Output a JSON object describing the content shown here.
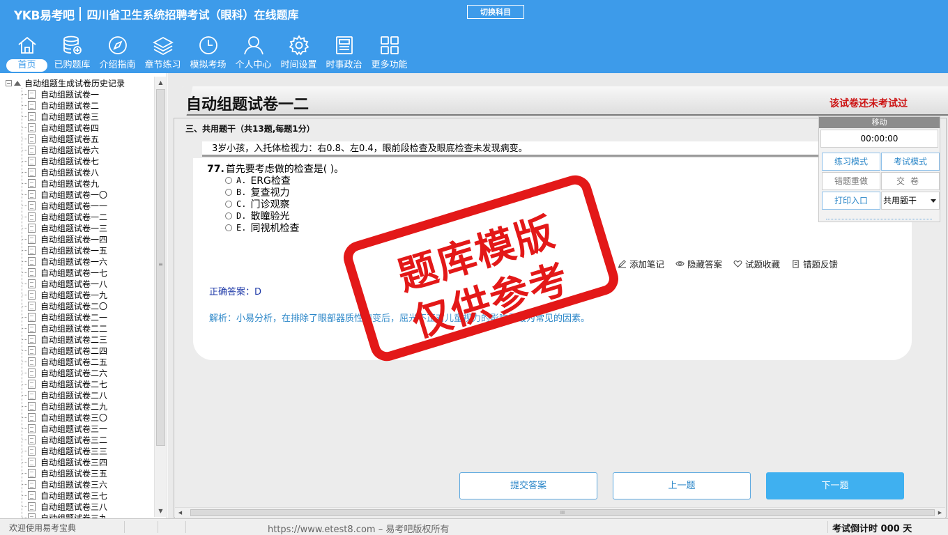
{
  "header": {
    "logo": "YKB易考吧",
    "title": "四川省卫生系统招聘考试（眼科）在线题库",
    "switch_subject": "切换科目"
  },
  "nav": [
    {
      "label": "首页",
      "icon": "home-icon",
      "active": true
    },
    {
      "label": "已购题库",
      "icon": "database-icon"
    },
    {
      "label": "介绍指南",
      "icon": "compass-icon"
    },
    {
      "label": "章节练习",
      "icon": "layers-icon"
    },
    {
      "label": "模拟考场",
      "icon": "clock-icon"
    },
    {
      "label": "个人中心",
      "icon": "user-icon"
    },
    {
      "label": "时间设置",
      "icon": "gear-icon"
    },
    {
      "label": "时事政治",
      "icon": "newspaper-icon"
    },
    {
      "label": "更多功能",
      "icon": "grid-icon"
    }
  ],
  "sidebar": {
    "root_label": "自动组题生成试卷历史记录",
    "items": [
      "自动组题试卷一",
      "自动组题试卷二",
      "自动组题试卷三",
      "自动组题试卷四",
      "自动组题试卷五",
      "自动组题试卷六",
      "自动组题试卷七",
      "自动组题试卷八",
      "自动组题试卷九",
      "自动组题试卷一〇",
      "自动组题试卷一一",
      "自动组题试卷一二",
      "自动组题试卷一三",
      "自动组题试卷一四",
      "自动组题试卷一五",
      "自动组题试卷一六",
      "自动组题试卷一七",
      "自动组题试卷一八",
      "自动组题试卷一九",
      "自动组题试卷二〇",
      "自动组题试卷二一",
      "自动组题试卷二二",
      "自动组题试卷二三",
      "自动组题试卷二四",
      "自动组题试卷二五",
      "自动组题试卷二六",
      "自动组题试卷二七",
      "自动组题试卷二八",
      "自动组题试卷二九",
      "自动组题试卷三〇",
      "自动组题试卷三一",
      "自动组题试卷三二",
      "自动组题试卷三三",
      "自动组题试卷三四",
      "自动组题试卷三五",
      "自动组题试卷三六",
      "自动组题试卷三七",
      "自动组题试卷三八",
      "自动组题试卷三九"
    ],
    "scroll_grip": "≡"
  },
  "paper": {
    "title": "自动组题试卷一二",
    "status": "该试卷还未考试过",
    "section": "三、共用题干（共13题,每题1分）",
    "stem": "3岁小孩，入托体检视力：右0.8、左0.4，眼前段检查及眼底检查未发现病变。",
    "question_number": "77.",
    "question_text": "首先要考虑做的检查是( )。",
    "options": [
      {
        "key": "A.",
        "text": "ERG检查"
      },
      {
        "key": "B.",
        "text": "复查视力"
      },
      {
        "key": "C.",
        "text": "门诊观察"
      },
      {
        "key": "D.",
        "text": "散瞳验光"
      },
      {
        "key": "E.",
        "text": "同视机检查"
      }
    ],
    "actions": {
      "note": "添加笔记",
      "hide_answer": "隐藏答案",
      "favorite": "试题收藏",
      "feedback": "错题反馈"
    },
    "answer": "正确答案：D",
    "analysis": "解析：小易分析，在排除了眼部器质性病变后，屈光不正对儿童视力的影响是最为常见的因素。"
  },
  "watermark": {
    "line1": "题库模版",
    "line2": "仅供参考",
    "color": "#e31818"
  },
  "panel": {
    "header": "移动",
    "timer": "00:00:00",
    "practice_mode": "练习模式",
    "exam_mode": "考试模式",
    "redo_wrong": "错题重做",
    "hand_in": "交卷",
    "print_entry": "打印入口",
    "question_type": "共用题干"
  },
  "buttons": {
    "submit": "提交答案",
    "prev": "上一题",
    "next": "下一题"
  },
  "hscroll_grip": "III",
  "status": {
    "welcome": "欢迎使用易考宝典",
    "url": "https://www.etest8.com – 易考吧版权所有",
    "countdown": "考试倒计时 000 天"
  },
  "colors": {
    "header": "#3d9bea",
    "accent": "#2a86c8",
    "alert": "#cc1111",
    "next_button": "#3fb0f0"
  }
}
